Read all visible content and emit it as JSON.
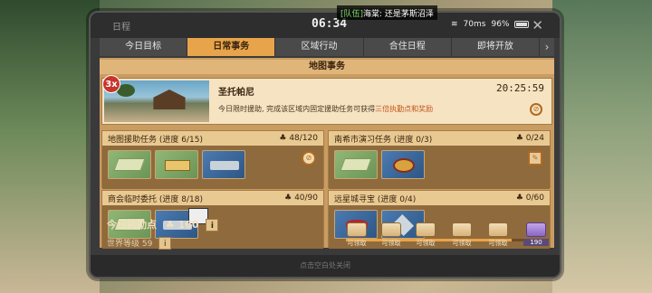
{
  "header": {
    "title": "日程",
    "clock": "06:34",
    "chat_tag": "[队伍]",
    "chat_text": "海棠: 还是茅斯沼泽",
    "wifi": "70ms",
    "battery": "96%",
    "close_symbol": "✕"
  },
  "tabs": [
    {
      "label": "今日目标",
      "active": false
    },
    {
      "label": "日常事务",
      "active": true
    },
    {
      "label": "区域行动",
      "active": false
    },
    {
      "label": "合住日程",
      "active": false
    },
    {
      "label": "即将开放",
      "active": false
    }
  ],
  "section_title": "地图事务",
  "banner": {
    "multiplier": "3x",
    "name": "圣托帕尼",
    "desc_prefix": "今日限时援助, 完成该区域内固定援助任务可获得",
    "desc_highlight": "三倍执勤点和奖励",
    "time": "20:25:59"
  },
  "tasks": [
    {
      "name": "地图援助任务 (进度 6/15)",
      "points": "48/120",
      "rewards": [
        "map",
        "gold-bars",
        "device"
      ],
      "action": "compass"
    },
    {
      "name": "南希市演习任务 (进度 0/3)",
      "points": "0/24",
      "rewards": [
        "map",
        "wings-badge"
      ],
      "action": "feather"
    },
    {
      "name": "商会临时委托 (进度 8/18)",
      "points": "40/90",
      "rewards": [
        "map",
        "device"
      ],
      "action": ""
    },
    {
      "name": "远星城寻宝 (进度 0/4)",
      "points": "0/60",
      "rewards": [
        "gems",
        "cube"
      ],
      "action": ""
    }
  ],
  "footer": {
    "points_label": "今日执勤点",
    "points_value": "160",
    "world_level": "世界等级 59",
    "progress_fraction": 0.84,
    "chests": [
      {
        "label": "可领取"
      },
      {
        "label": "可领取"
      },
      {
        "label": "可领取"
      },
      {
        "label": "可领取"
      },
      {
        "label": "可领取"
      },
      {
        "label": "190"
      }
    ],
    "bottom_text": "点击空白处关闭"
  }
}
